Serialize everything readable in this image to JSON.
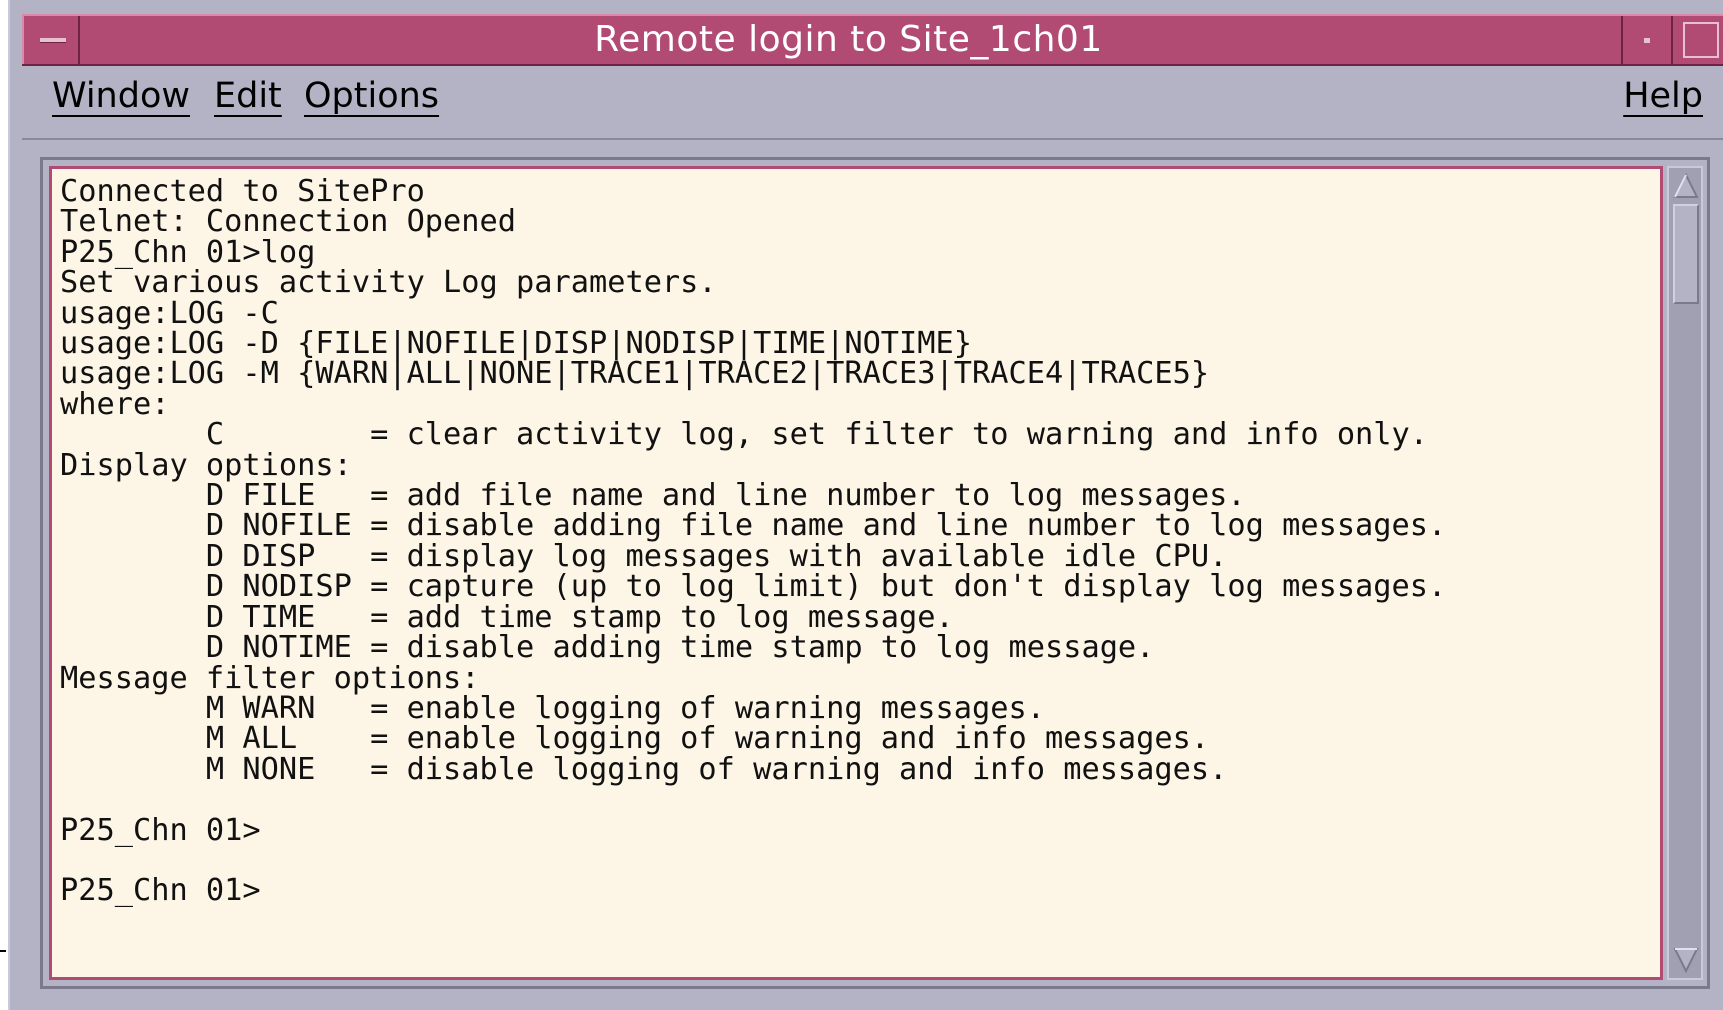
{
  "window": {
    "title": "Remote login to Site_1ch01"
  },
  "menubar": {
    "items": [
      {
        "label": "Window"
      },
      {
        "label": "Edit"
      },
      {
        "label": "Options"
      }
    ],
    "help_label": "Help"
  },
  "terminal": {
    "lines": [
      "Connected to SitePro",
      "Telnet: Connection Opened",
      "P25_Chn 01>log",
      "Set various activity Log parameters.",
      "usage:LOG -C",
      "usage:LOG -D {FILE|NOFILE|DISP|NODISP|TIME|NOTIME}",
      "usage:LOG -M {WARN|ALL|NONE|TRACE1|TRACE2|TRACE3|TRACE4|TRACE5}",
      "where:",
      "        C        = clear activity log, set filter to warning and info only.",
      "Display options:",
      "        D FILE   = add file name and line number to log messages.",
      "        D NOFILE = disable adding file name and line number to log messages.",
      "        D DISP   = display log messages with available idle CPU.",
      "        D NODISP = capture (up to log limit) but don't display log messages.",
      "        D TIME   = add time stamp to log message.",
      "        D NOTIME = disable adding time stamp to log message.",
      "Message filter options:",
      "        M WARN   = enable logging of warning messages.",
      "        M ALL    = enable logging of warning and info messages.",
      "        M NONE   = disable logging of warning and info messages.",
      "",
      "P25_Chn 01>",
      "",
      "P25_Chn 01>"
    ]
  },
  "icons": {
    "window_menu": "window-menu-icon",
    "minimize": "minimize-icon",
    "maximize": "maximize-icon",
    "scroll_up": "scroll-up-arrow-icon",
    "scroll_down": "scroll-down-arrow-icon"
  },
  "colors": {
    "titlebar": "#b24b73",
    "terminal_bg": "#fdf5e6",
    "chrome": "#b3b3c5"
  }
}
